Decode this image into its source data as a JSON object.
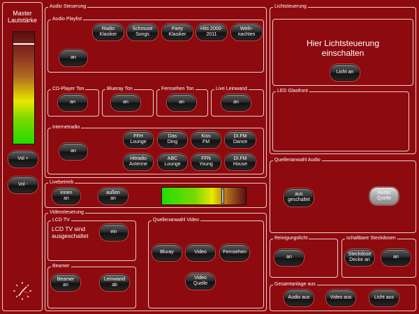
{
  "master": {
    "label": "Master\nLautstärke",
    "vol_up": "Vol +",
    "vol_down": "Vol -",
    "volume_level": 0.9
  },
  "audio": {
    "title": "Audio Steuerung",
    "playlist": {
      "title": "Audio Playlist",
      "buttons": [
        "Radio\nKlasiker",
        "Schmuse\nSongs",
        "Party\nKlasiker",
        "Hits 2000-\n2011",
        "Weih-\nnachten"
      ],
      "on_label": "an"
    },
    "cd": {
      "title": "CD-Player Ton",
      "button": "an"
    },
    "bluray": {
      "title": "Blueray Ton",
      "button": "an"
    },
    "tv": {
      "title": "Fernsehen Ton",
      "button": "an"
    },
    "beamer": {
      "title": "Live Leinwand",
      "button": "an"
    },
    "internet": {
      "title": "Internetradio",
      "on_label": "an",
      "stations": [
        "FFH\nLounge",
        "Das\nDing",
        "Kiss\nFM",
        "DI.FM\nDance",
        "Hitradio\nAntenne",
        "ABC\nLounge",
        "FFN\nYoung",
        "DI.FM\nHouse"
      ]
    }
  },
  "live": {
    "title": "Livebetrieb",
    "inside": "innen\nan",
    "outside": "außen\nan",
    "level": 0.73
  },
  "video": {
    "title": "Videosteuerung",
    "lcd": {
      "title": "LCD TV",
      "status": "LCD TV sind ausgeschaltet",
      "button": "ein"
    },
    "beamer": {
      "title": "Beamer",
      "on": "Beamer\nan",
      "screen": "Leinwand\nab"
    },
    "source": {
      "title": "Quellenanwahl Video",
      "bluray": "Bluray",
      "video": "Video",
      "tv": "Fernsehen",
      "video_source": "Video\nQuelle"
    }
  },
  "light": {
    "title": "Lichtsteuerung",
    "prompt": "Hier Lichtsteuerung einschalten",
    "button": "Licht an",
    "led_title": "LED Glasfront"
  },
  "audio_source": {
    "title": "Quellenanwahl Audio",
    "off": "aus\ngeschaltet",
    "source": "Audio\nQuelle"
  },
  "cleaning": {
    "title": "Reinigungslicht",
    "button": "an"
  },
  "sockets": {
    "title": "schaltbare Steckdosen",
    "ceiling": "Steckdose\nDecke an",
    "button": "an"
  },
  "all": {
    "title": "Gesamtanlage aus",
    "audio_off": "Audio aus",
    "video_off": "Video aus",
    "light_off": "Licht aus"
  },
  "colors": {
    "background": "#8d0a0e",
    "border": "#e8d0d0",
    "meter_top": "#4a0a0a",
    "meter_green": "#22dd00",
    "meter_yellow": "#e8e800"
  }
}
